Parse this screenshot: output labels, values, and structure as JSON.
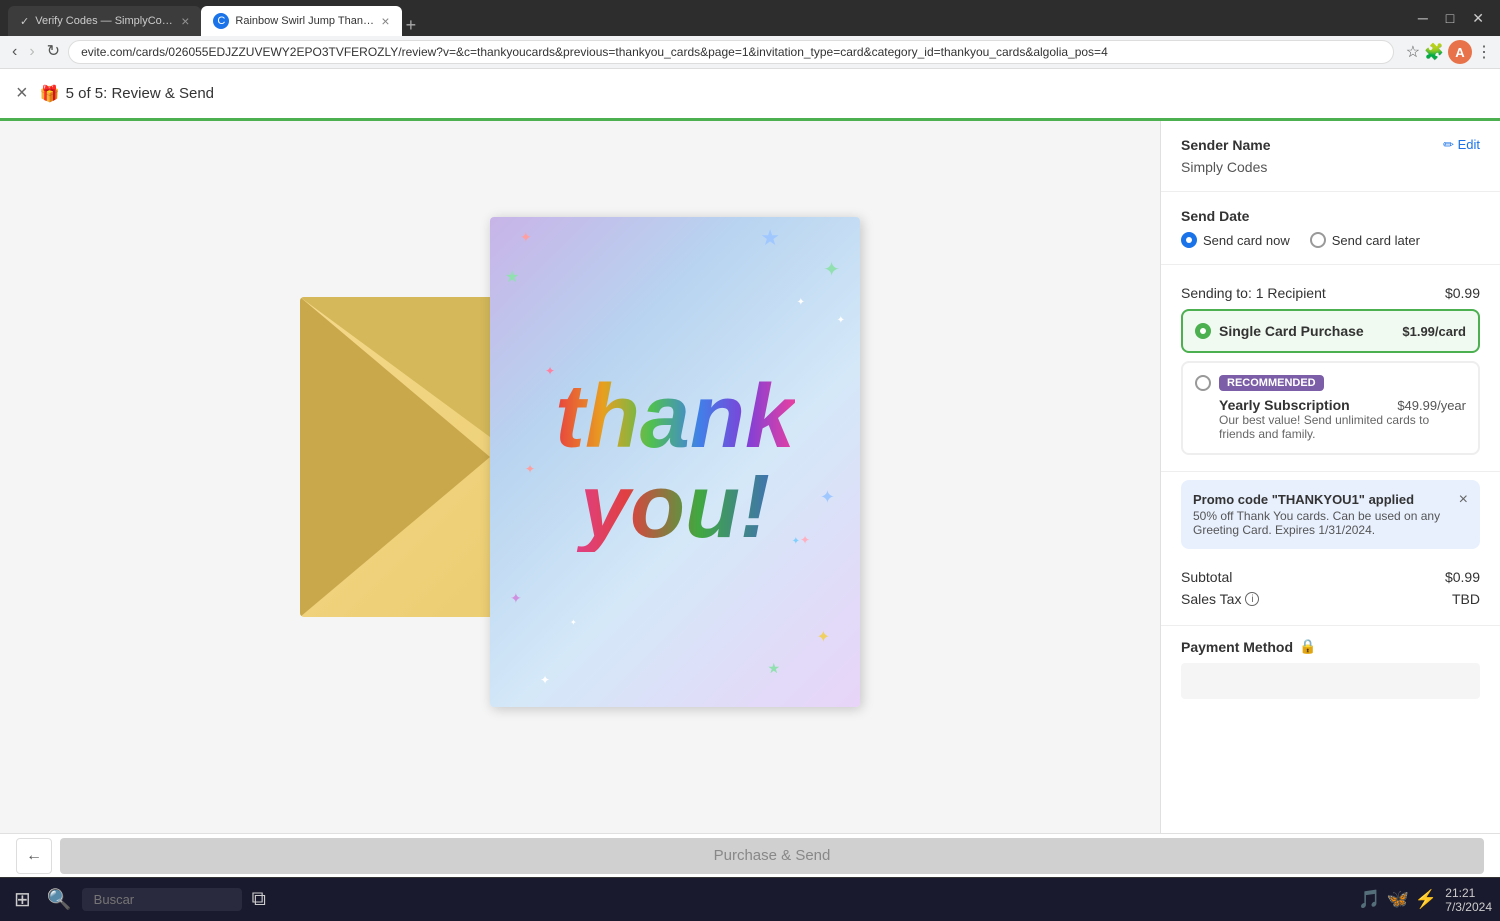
{
  "browser": {
    "tabs": [
      {
        "id": "tab1",
        "title": "Verify Codes — SimplyCodes",
        "favicon": "✓",
        "active": false
      },
      {
        "id": "tab2",
        "title": "Rainbow Swirl Jump Thank You...",
        "favicon": "C",
        "active": true
      }
    ],
    "url": "evite.com/cards/026055EDJZZUVEWY2EPO3TVFEROZLY/review?v=&c=thankyoucards&previous=thankyou_cards&page=1&invitation_type=card&category_id=thankyou_cards&algolia_pos=4",
    "new_tab_label": "+"
  },
  "app_bar": {
    "step_label": "5 of 5: Review & Send",
    "close_label": "×"
  },
  "card": {
    "thank_text": "thank",
    "you_text": "you!"
  },
  "sidebar": {
    "sender_name_section": {
      "title": "Sender Name",
      "edit_label": "✏ Edit",
      "value": "Simply Codes"
    },
    "send_date_section": {
      "title": "Send Date",
      "option_now_label": "Send card now",
      "option_later_label": "Send card later",
      "selected": "now"
    },
    "sending_section": {
      "label": "Sending to: 1 Recipient",
      "price": "$0.99"
    },
    "single_card": {
      "title": "Single Card Purchase",
      "price": "$1.99",
      "per": "/card",
      "selected": true
    },
    "yearly": {
      "badge": "RECOMMENDED",
      "title": "Yearly Subscription",
      "price": "$49.99",
      "per": "/year",
      "desc": "Our best value! Send unlimited cards to friends and family.",
      "selected": false
    },
    "promo": {
      "title": "Promo code \"THANKYOU1\" applied",
      "desc": "50% off Thank You cards. Can be used on any Greeting Card. Expires 1/31/2024.",
      "close_label": "×"
    },
    "subtotal": {
      "label": "Subtotal",
      "value": "$0.99",
      "tax_label": "Sales Tax",
      "tax_value": "TBD"
    },
    "payment": {
      "title": "Payment Method",
      "lock_icon": "🔒"
    }
  },
  "bottom_bar": {
    "back_label": "←",
    "purchase_label": "Purchase & Send"
  },
  "taskbar": {
    "search_placeholder": "Buscar",
    "time": "21:21",
    "date": "7/3/2024"
  }
}
